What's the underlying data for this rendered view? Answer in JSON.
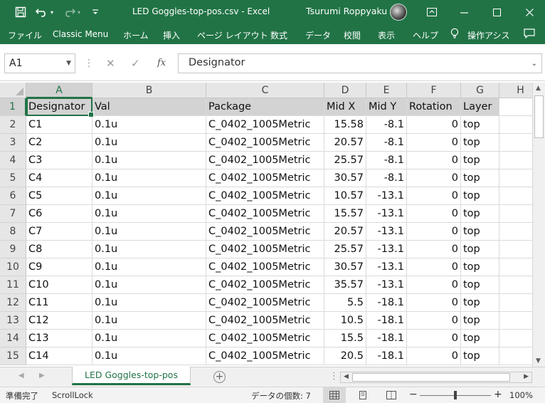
{
  "titlebar": {
    "title": "LED Goggles-top-pos.csv  -  Excel",
    "user": "Tsurumi Roppyaku",
    "icons": [
      "save-icon",
      "undo-icon",
      "redo-icon",
      "customize-icon",
      "ribbon-display-icon",
      "minimize-icon",
      "maximize-icon",
      "close-icon"
    ]
  },
  "ribbon": {
    "tabs": [
      "ファイル",
      "Classic Menu",
      "ホーム",
      "挿入",
      "ページ レイアウト",
      "数式",
      "データ",
      "校閲",
      "表示",
      "ヘルプ",
      "操作アシス"
    ]
  },
  "formula_bar": {
    "name_box": "A1",
    "cancel_glyph": "✕",
    "enter_glyph": "✓",
    "fx_glyph": "fx",
    "content": "Designator"
  },
  "grid": {
    "column_headers": [
      "A",
      "B",
      "C",
      "D",
      "E",
      "F",
      "G",
      "H"
    ],
    "row_numbers": [
      "1",
      "2",
      "3",
      "4",
      "5",
      "6",
      "7",
      "8",
      "9",
      "10",
      "11",
      "12",
      "13",
      "14",
      "15"
    ],
    "header_row": [
      "Designator",
      "Val",
      "Package",
      "Mid X",
      "Mid Y",
      "Rotation",
      "Layer"
    ],
    "rows": [
      [
        "C1",
        "0.1u",
        "C_0402_1005Metric",
        "15.58",
        "-8.1",
        "0",
        "top"
      ],
      [
        "C2",
        "0.1u",
        "C_0402_1005Metric",
        "20.57",
        "-8.1",
        "0",
        "top"
      ],
      [
        "C3",
        "0.1u",
        "C_0402_1005Metric",
        "25.57",
        "-8.1",
        "0",
        "top"
      ],
      [
        "C4",
        "0.1u",
        "C_0402_1005Metric",
        "30.57",
        "-8.1",
        "0",
        "top"
      ],
      [
        "C5",
        "0.1u",
        "C_0402_1005Metric",
        "10.57",
        "-13.1",
        "0",
        "top"
      ],
      [
        "C6",
        "0.1u",
        "C_0402_1005Metric",
        "15.57",
        "-13.1",
        "0",
        "top"
      ],
      [
        "C7",
        "0.1u",
        "C_0402_1005Metric",
        "20.57",
        "-13.1",
        "0",
        "top"
      ],
      [
        "C8",
        "0.1u",
        "C_0402_1005Metric",
        "25.57",
        "-13.1",
        "0",
        "top"
      ],
      [
        "C9",
        "0.1u",
        "C_0402_1005Metric",
        "30.57",
        "-13.1",
        "0",
        "top"
      ],
      [
        "C10",
        "0.1u",
        "C_0402_1005Metric",
        "35.57",
        "-13.1",
        "0",
        "top"
      ],
      [
        "C11",
        "0.1u",
        "C_0402_1005Metric",
        "5.5",
        "-18.1",
        "0",
        "top"
      ],
      [
        "C12",
        "0.1u",
        "C_0402_1005Metric",
        "10.5",
        "-18.1",
        "0",
        "top"
      ],
      [
        "C13",
        "0.1u",
        "C_0402_1005Metric",
        "15.5",
        "-18.1",
        "0",
        "top"
      ],
      [
        "C14",
        "0.1u",
        "C_0402_1005Metric",
        "20.5",
        "-18.1",
        "0",
        "top"
      ]
    ]
  },
  "sheet_tabs": [
    "LED Goggles-top-pos"
  ],
  "status_bar": {
    "ready": "準備完了",
    "scroll_lock": "ScrollLock",
    "count": "データの個数: 7",
    "zoom_out": "−",
    "zoom_in": "+",
    "zoom": "100%"
  },
  "colors": {
    "accent": "#217346",
    "header_fill": "#d3d3d3"
  }
}
